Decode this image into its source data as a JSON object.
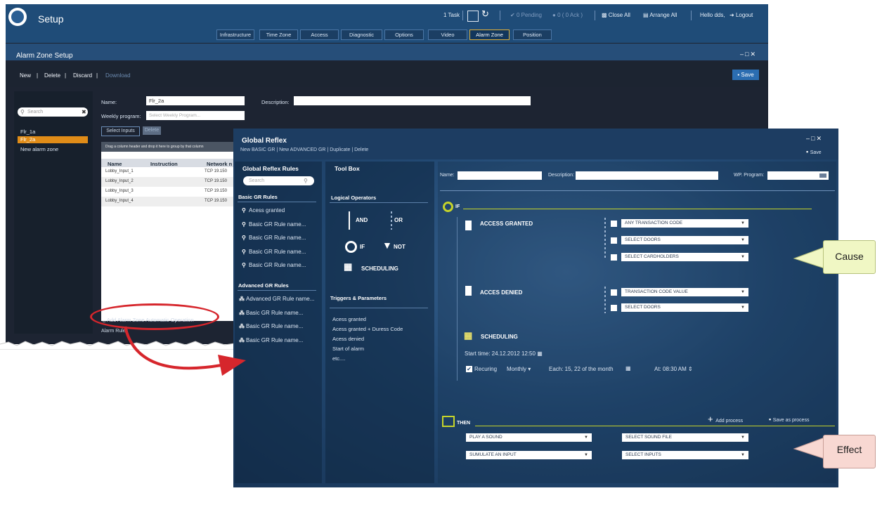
{
  "app": {
    "title": "Setup"
  },
  "topbar": {
    "task": "1 Task",
    "pending": "0 Pending",
    "ack": "0 ( 0 Ack )",
    "close_all": "Close All",
    "arrange_all": "Arrange All",
    "hello": "Hello dds,",
    "logout": "Logout"
  },
  "tabs": [
    "Infrastructure",
    "Time Zone",
    "Access",
    "Diagnostic",
    "Options",
    "Video",
    "Alarm Zone",
    "Position"
  ],
  "alarm_zone": {
    "title": "Alarm Zone Setup",
    "commands": {
      "new": "New",
      "delete": "Delete",
      "discard": "Discard",
      "download": "Download"
    },
    "save": "Save",
    "search_placeholder": "Search",
    "items": [
      "Flr_1a",
      "Flr_2a",
      "New alarm zone"
    ],
    "name_label": "Name:",
    "name_value": "Flr_2a",
    "description_label": "Description:",
    "weekly_label": "Weekly program:",
    "weekly_placeholder": "Select Weekly Program...",
    "select_inputs": "Select Inputs",
    "delete_btn": "Delete",
    "group_hint": "Drag a column header and drop it here to group by that column",
    "columns": [
      "Name",
      "Instruction",
      "Network n"
    ],
    "rows": [
      {
        "name": "Lobby_Input_1",
        "network": "TCP 19.150"
      },
      {
        "name": "Lobby_Input_2",
        "network": "TCP 19.150"
      },
      {
        "name": "Lobby_Input_3",
        "network": "TCP 19.150"
      },
      {
        "name": "Lobby_Input_4",
        "network": "TCP 19.150"
      }
    ],
    "add_operation": "Add Alarm Zone Automatic Operation",
    "below_text": "Alarm Rules"
  },
  "gr": {
    "title": "Global Reflex",
    "subtitle": "New BASIC GR  |  New ADVANCED GR   |  Duplicate  |  Delete",
    "save": "Save",
    "rules_header": "Global Reflex Rules",
    "search_placeholder": "Search",
    "basic_header": "Basic GR Rules",
    "basic_items": [
      "Acess granted",
      "Basic GR Rule name...",
      "Basic GR Rule name...",
      "Basic GR Rule name...",
      "Basic GR Rule name..."
    ],
    "advanced_header": "Advanced GR Rules",
    "advanced_items": [
      "Advanced GR Rule name...",
      "Basic GR Rule name...",
      "Basic GR Rule name...",
      "Basic GR Rule name..."
    ],
    "toolbox_header": "Tool Box",
    "logical_header": "Logical Operators",
    "op_and": "AND",
    "op_or": "OR",
    "op_if": "IF",
    "op_not": "NOT",
    "op_scheduling": "SCHEDULING",
    "triggers_header": "Triggers & Parameters",
    "triggers": [
      "Acess granted",
      "Acess granted + Duress Code",
      "Acess denied",
      "Start of alarm",
      "etc...."
    ],
    "name_label": "Name:",
    "description_label": "Description:",
    "wp_label": "WP. Program:",
    "if_label": "IF",
    "access_granted": "ACCESS GRANTED",
    "granted_dropdowns": [
      "ANY TRANSACTION CODE",
      "SELECT DOORS",
      "SELECT CARDHOLDERS"
    ],
    "access_denied": "ACCES DENIED",
    "denied_dropdowns": [
      "TRANSACTION CODE VALUE",
      "SELECT DOORS"
    ],
    "scheduling": "SCHEDULING",
    "start_time": "Start time:  24.12.2012 12:50",
    "recurring": "Recuring",
    "monthly": "Monthly",
    "each": "Each: 15, 22 of the month",
    "at": "At: 08:30 AM",
    "then_label": "THEN",
    "add_process": "Add process",
    "save_as_process": "Save as process",
    "then_left": [
      "PLAY A SOUND",
      "SUMULATE AN INPUT"
    ],
    "then_right": [
      "SELECT SOUND FILE",
      "SELECT INPUTS"
    ]
  },
  "callouts": {
    "cause": "Cause",
    "effect": "Effect"
  },
  "colors": {
    "accent_orange": "#e08c18",
    "title_bar": "#1f4c78",
    "if_yellow": "#c6d42a",
    "callout_red": "#d6262c"
  }
}
